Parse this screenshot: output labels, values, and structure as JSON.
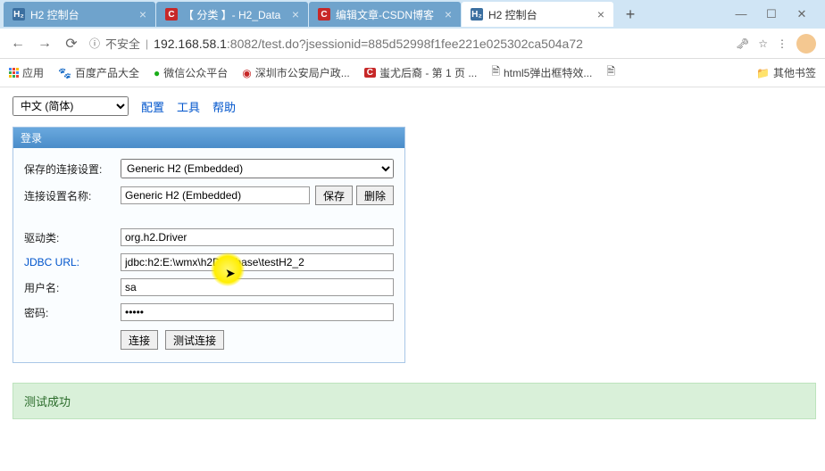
{
  "tabs": [
    {
      "title": "H2 控制台",
      "favicon": "h2"
    },
    {
      "title": "【 分类 】- H2_Data",
      "favicon": "c"
    },
    {
      "title": "编辑文章-CSDN博客",
      "favicon": "c"
    },
    {
      "title": "H2 控制台",
      "favicon": "h2",
      "active": true
    }
  ],
  "nav": {
    "insecure_label": "不安全",
    "url_host": "192.168.58.1",
    "url_port": ":8082",
    "url_path": "/test.do?jsessionid=885d52998f1fee221e025302ca504a72"
  },
  "bookmarks": {
    "apps": "应用",
    "items": [
      "百度产品大全",
      "微信公众平台",
      "深圳市公安局户政...",
      "蚩尤后裔 - 第 1 页 ...",
      "html5弹出框特效...",
      ""
    ],
    "other": "其他书签"
  },
  "page": {
    "lang_selected": "中文 (简体)",
    "links": {
      "config": "配置",
      "tools": "工具",
      "help": "帮助"
    },
    "panel_title": "登录",
    "labels": {
      "saved_settings": "保存的连接设置:",
      "setting_name": "连接设置名称:",
      "driver": "驱动类:",
      "jdbc_url": "JDBC URL:",
      "user": "用户名:",
      "password": "密码:"
    },
    "values": {
      "saved_settings": "Generic H2 (Embedded)",
      "setting_name": "Generic H2 (Embedded)",
      "driver": "org.h2.Driver",
      "jdbc_url": "jdbc:h2:E:\\wmx\\h2Database\\testH2_2",
      "user": "sa",
      "password": "•••••"
    },
    "buttons": {
      "save": "保存",
      "delete": "删除",
      "connect": "连接",
      "test": "测试连接"
    },
    "status": "测试成功"
  }
}
